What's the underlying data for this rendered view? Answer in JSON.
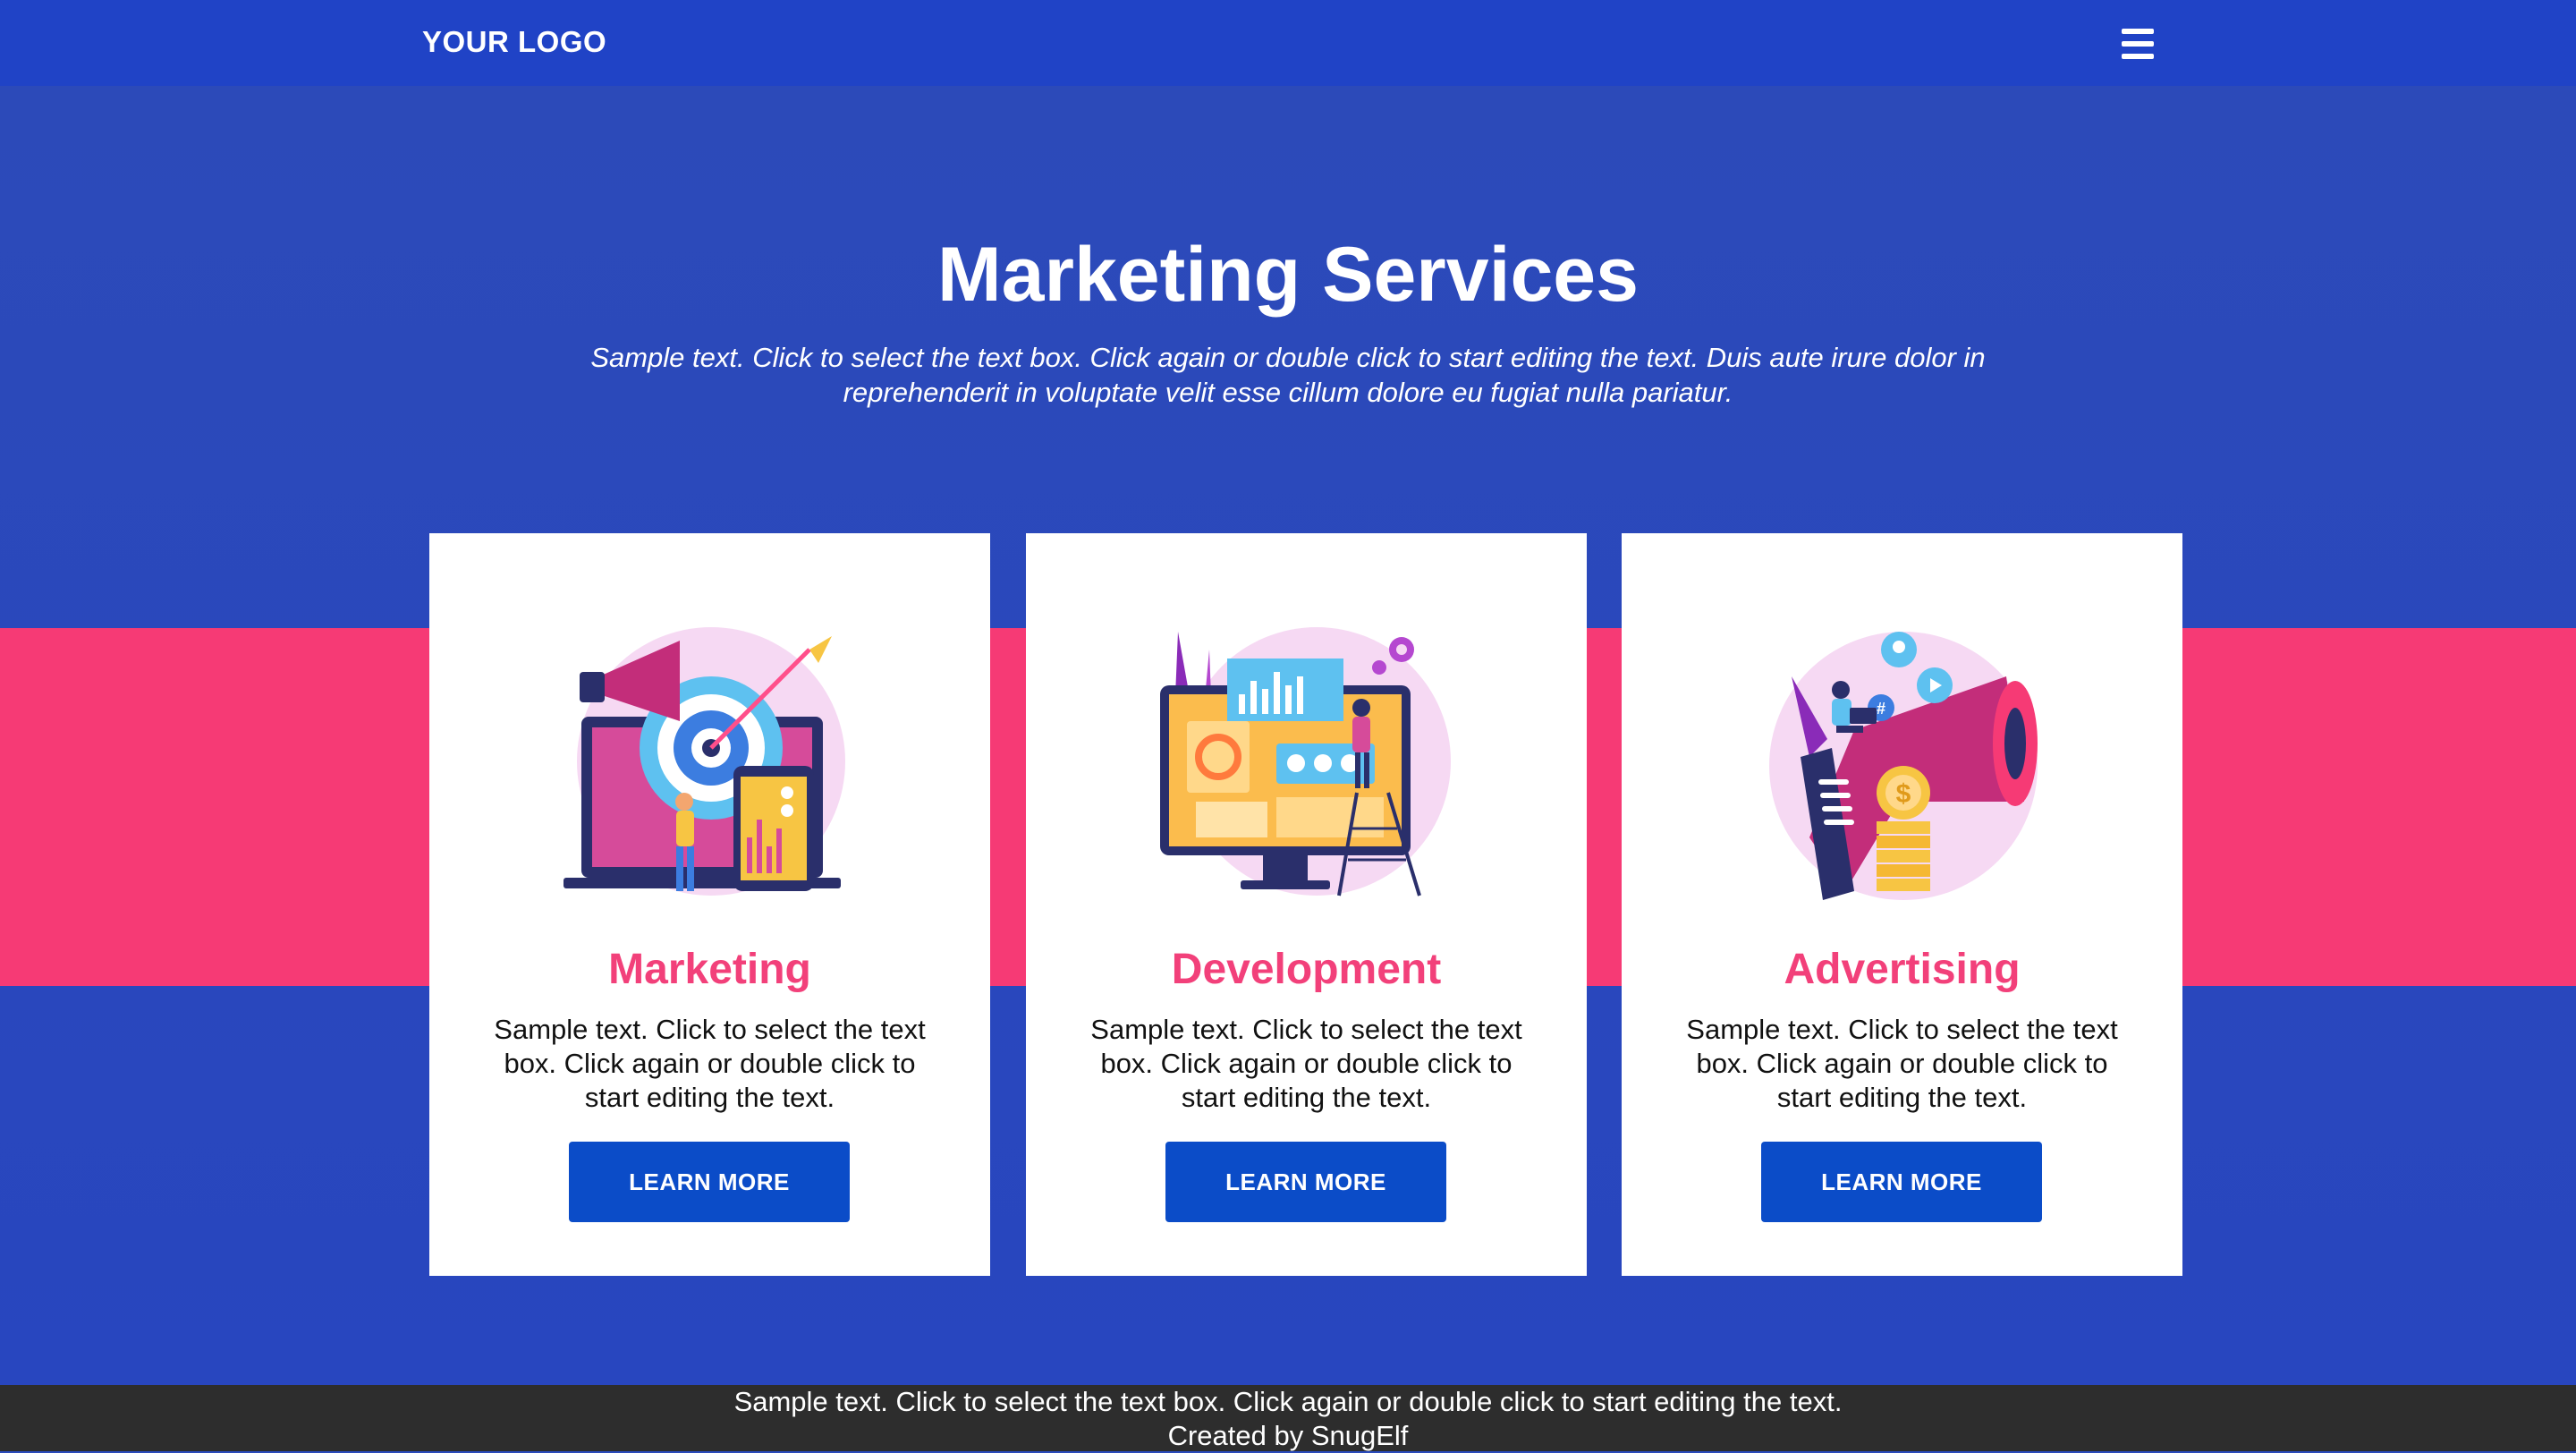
{
  "header": {
    "logo": "YOUR LOGO",
    "menu_icon": "hamburger-menu-icon"
  },
  "hero": {
    "title": "Marketing Services",
    "subtitle": "Sample text. Click to select the text box. Click again or double click to start editing the text. Duis aute irure dolor in reprehenderit in voluptate velit esse cillum dolore eu fugiat nulla pariatur."
  },
  "cards": [
    {
      "title": "Marketing",
      "text": "Sample text. Click to select the text box. Click again or double click to start editing the text.",
      "button": "LEARN MORE",
      "illustration": "marketing-target-illustration"
    },
    {
      "title": "Development",
      "text": "Sample text. Click to select the text box. Click again or double click to start editing the text.",
      "button": "LEARN MORE",
      "illustration": "development-monitor-illustration"
    },
    {
      "title": "Advertising",
      "text": "Sample text. Click to select the text box. Click again or double click to start editing the text.",
      "button": "LEARN MORE",
      "illustration": "advertising-megaphone-illustration"
    }
  ],
  "footer": {
    "line1": "Sample text. Click to select the text box. Click again or double click to start editing the text.",
    "line2": "Created by SnugElf"
  },
  "colors": {
    "header_bg": "#2043c6",
    "hero_bg": "#2b4bbb",
    "accent_band": "#f63a75",
    "card_title": "#f2407a",
    "button_bg": "#0b4cc8",
    "footer_bg": "#2d2d2d"
  }
}
